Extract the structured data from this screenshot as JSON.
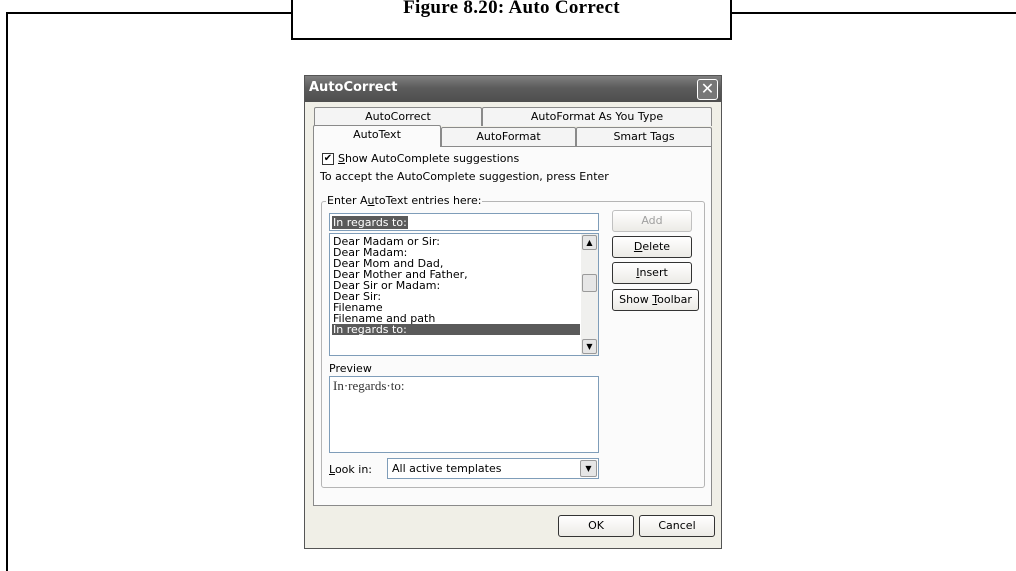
{
  "document": {
    "figure_caption": "Figure 8.20: Auto Correct"
  },
  "dialog": {
    "title": "AutoCorrect",
    "close_icon": "close-icon",
    "tabs_back": [
      "AutoCorrect",
      "AutoFormat As You Type"
    ],
    "tabs_front": [
      "AutoText",
      "AutoFormat",
      "Smart Tags"
    ],
    "active_tab": "AutoText",
    "show_autocomplete": {
      "checked": true,
      "label_underlined": "S",
      "label_rest": "how AutoComplete suggestions"
    },
    "accept_hint": "To accept the AutoComplete suggestion, press Enter",
    "entries_group": {
      "label_pre": "Enter A",
      "label_underlined": "u",
      "label_post": "toText entries here:",
      "input_value": "In regards to:"
    },
    "entries": [
      "Dear Madam or Sir:",
      "Dear Madam:",
      "Dear Mom and Dad,",
      "Dear Mother and Father,",
      "Dear Sir or Madam:",
      "Dear Sir:",
      "Filename",
      "Filename and path",
      "In regards to:"
    ],
    "selected_entry": "In regards to:",
    "buttons": {
      "add": "Add",
      "delete_underlined": "D",
      "delete_rest": "elete",
      "insert_underlined": "I",
      "insert_rest": "nsert",
      "show_toolbar_pre": "Show ",
      "show_toolbar_underlined": "T",
      "show_toolbar_post": "oolbar"
    },
    "preview_label": "Preview",
    "preview_text": "In·regards·to:",
    "look_in": {
      "label_underlined": "L",
      "label_rest": "ook in:",
      "value": "All active templates"
    },
    "footer": {
      "ok": "OK",
      "cancel": "Cancel"
    }
  }
}
